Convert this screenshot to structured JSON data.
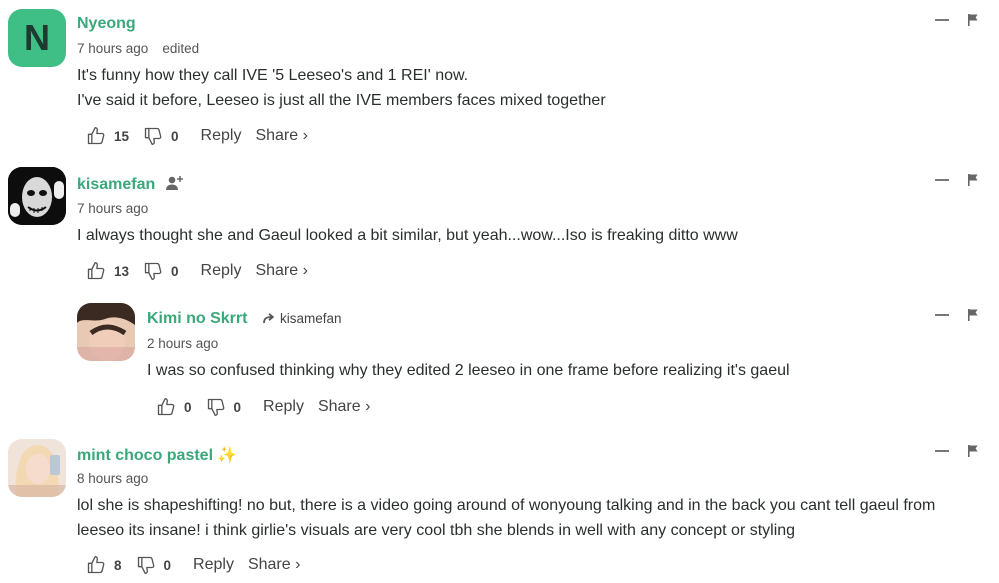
{
  "comments": [
    {
      "author": "Nyeong",
      "avatar_letter": "N",
      "time": "7 hours ago",
      "edited": "edited",
      "lines": [
        "It's funny how they call IVE '5 Leeseo's and 1 REI' now.",
        "I've said it before, Leeseo is just all the IVE members faces mixed together"
      ],
      "likes": "15",
      "dislikes": "0",
      "reply_label": "Reply",
      "share_label": "Share ›"
    },
    {
      "author": "kisamefan",
      "time": "7 hours ago",
      "lines": [
        "I always thought she and Gaeul looked a bit similar, but yeah...wow...Iso is freaking ditto www"
      ],
      "likes": "13",
      "dislikes": "0",
      "reply_label": "Reply",
      "share_label": "Share ›"
    },
    {
      "author": "Kimi no Skrrt",
      "reply_to": "kisamefan",
      "time": "2 hours ago",
      "lines": [
        "I was so confused thinking why they edited 2 leeseo in one frame before realizing it's gaeul"
      ],
      "likes": "0",
      "dislikes": "0",
      "reply_label": "Reply",
      "share_label": "Share ›"
    },
    {
      "author": "mint choco pastel",
      "author_emoji": "✨",
      "time": "8 hours ago",
      "lines": [
        "lol she is shapeshifting! no but, there is a video going around of wonyoung talking and in the back you cant tell gaeul from",
        "leeseo its insane! i think girlie's visuals are very cool tbh she blends in well with any concept or styling"
      ],
      "likes": "8",
      "dislikes": "0",
      "reply_label": "Reply",
      "share_label": "Share ›"
    }
  ]
}
